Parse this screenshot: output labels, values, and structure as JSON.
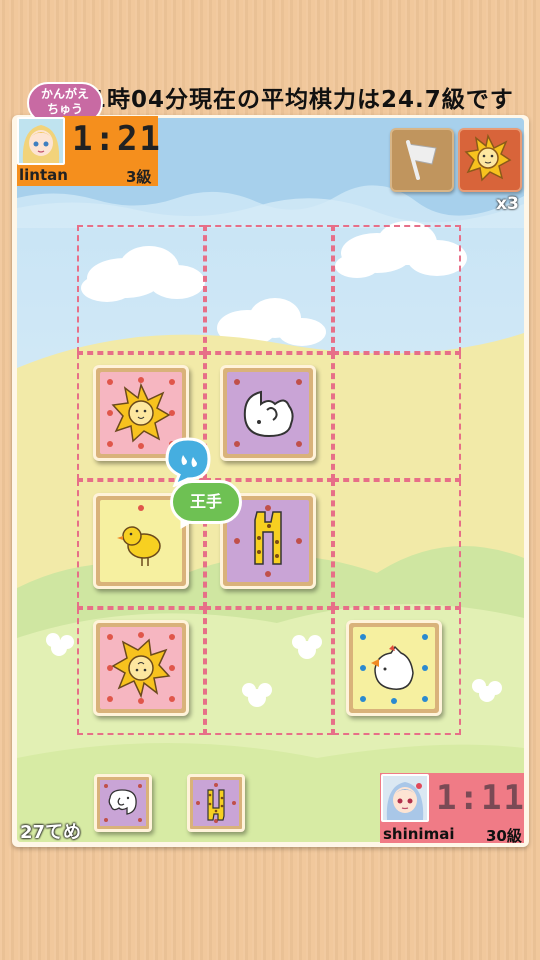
{
  "ticker": "1時04分現在の平均棋力は24.7級です",
  "thinking_bubble": [
    "かんがえ",
    "ちゅう"
  ],
  "opponent": {
    "name": "lintan",
    "rank": "3級",
    "timer": "1:21"
  },
  "player": {
    "name": "shinimai",
    "rank": "30級",
    "timer": "1:11"
  },
  "buttons": {
    "resign_icon": "flag-icon",
    "hint_icon": "lion-icon",
    "hint_count": "x3"
  },
  "board": {
    "rows": 4,
    "cols": 3,
    "pieces": [
      {
        "row": 1,
        "col": 0,
        "type": "lion",
        "owner": "player",
        "color": "#f6b6c1"
      },
      {
        "row": 1,
        "col": 1,
        "type": "elephant",
        "owner": "opponent",
        "color": "#c9a4d6"
      },
      {
        "row": 2,
        "col": 0,
        "type": "chick",
        "owner": "player",
        "color": "#f6f0a0"
      },
      {
        "row": 2,
        "col": 1,
        "type": "giraffe",
        "owner": "opponent",
        "color": "#c9a4d6"
      },
      {
        "row": 3,
        "col": 0,
        "type": "lion",
        "owner": "opponent",
        "color": "#f6b6c1"
      },
      {
        "row": 3,
        "col": 2,
        "type": "hen",
        "owner": "opponent",
        "color": "#f6f0a0"
      }
    ]
  },
  "check_label": "王手",
  "hand": [
    {
      "type": "elephant",
      "color": "#c9a4d6"
    },
    {
      "type": "giraffe",
      "color": "#c9a4d6"
    }
  ],
  "move_count": "27てめ",
  "colors": {
    "opponent_bar": "#f58f1d",
    "player_bar": "#f07b86",
    "check_green": "#6ec153",
    "grid_dash": "#e76f88"
  }
}
